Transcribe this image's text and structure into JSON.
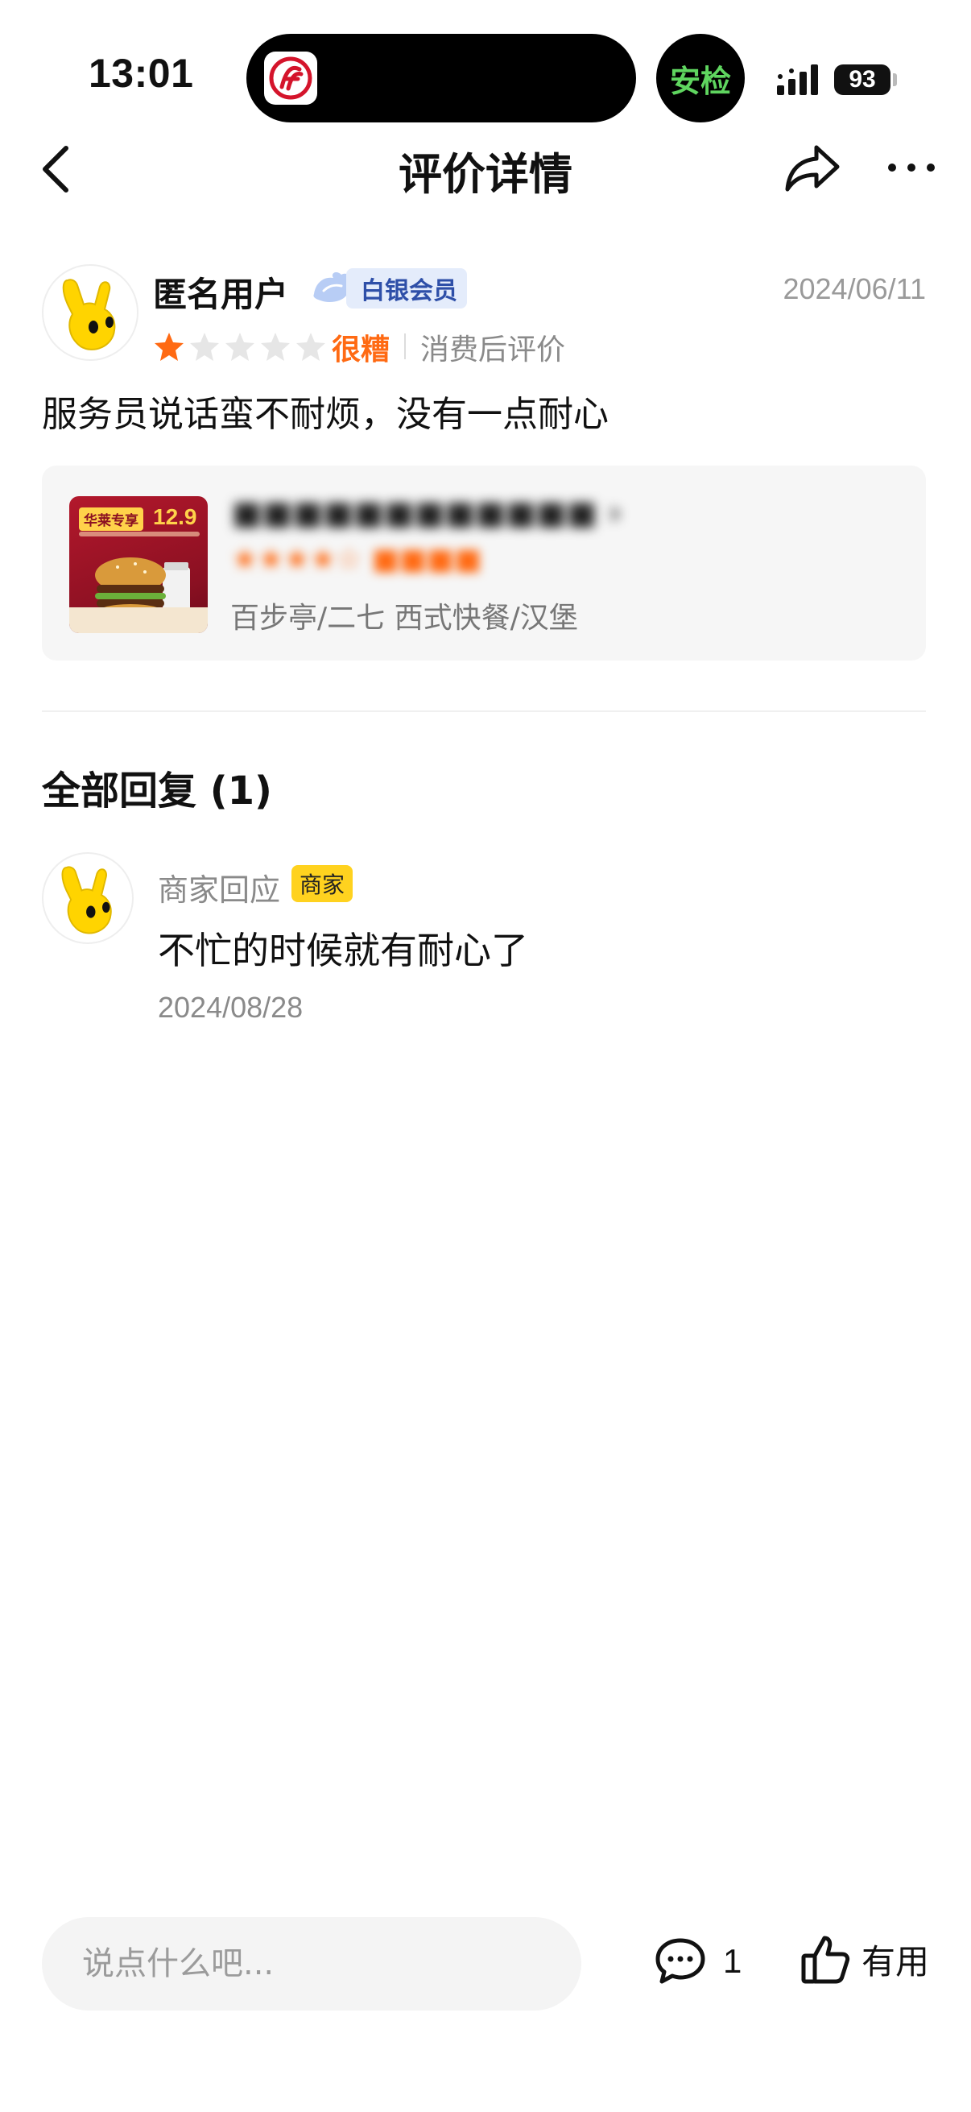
{
  "status_bar": {
    "time": "13:01",
    "security_label": "安检",
    "battery": "93"
  },
  "nav": {
    "title": "评价详情"
  },
  "review": {
    "user_name": "匿名用户",
    "member_level": "白银会员",
    "date": "2024/06/11",
    "star_rating": 1,
    "star_max": 5,
    "rating_text": "很糟",
    "rating_note": "消费后评价",
    "content": "服务员说话蛮不耐烦，没有一点耐心"
  },
  "shop": {
    "thumb_tag": "华莱专享",
    "thumb_price": "12.9",
    "location_category": "百步亭/二七 西式快餐/汉堡"
  },
  "replies": {
    "title": "全部回复 (1)",
    "items": [
      {
        "user": "商家回应",
        "badge": "商家",
        "content": "不忙的时候就有耐心了",
        "date": "2024/08/28"
      }
    ]
  },
  "bottom_bar": {
    "input_placeholder": "说点什么吧...",
    "comment_count": "1",
    "useful_label": "有用"
  },
  "colors": {
    "accent_orange": "#ff6a13",
    "merchant_badge": "#ffd21f",
    "member_badge_text": "#2e4fa8"
  }
}
